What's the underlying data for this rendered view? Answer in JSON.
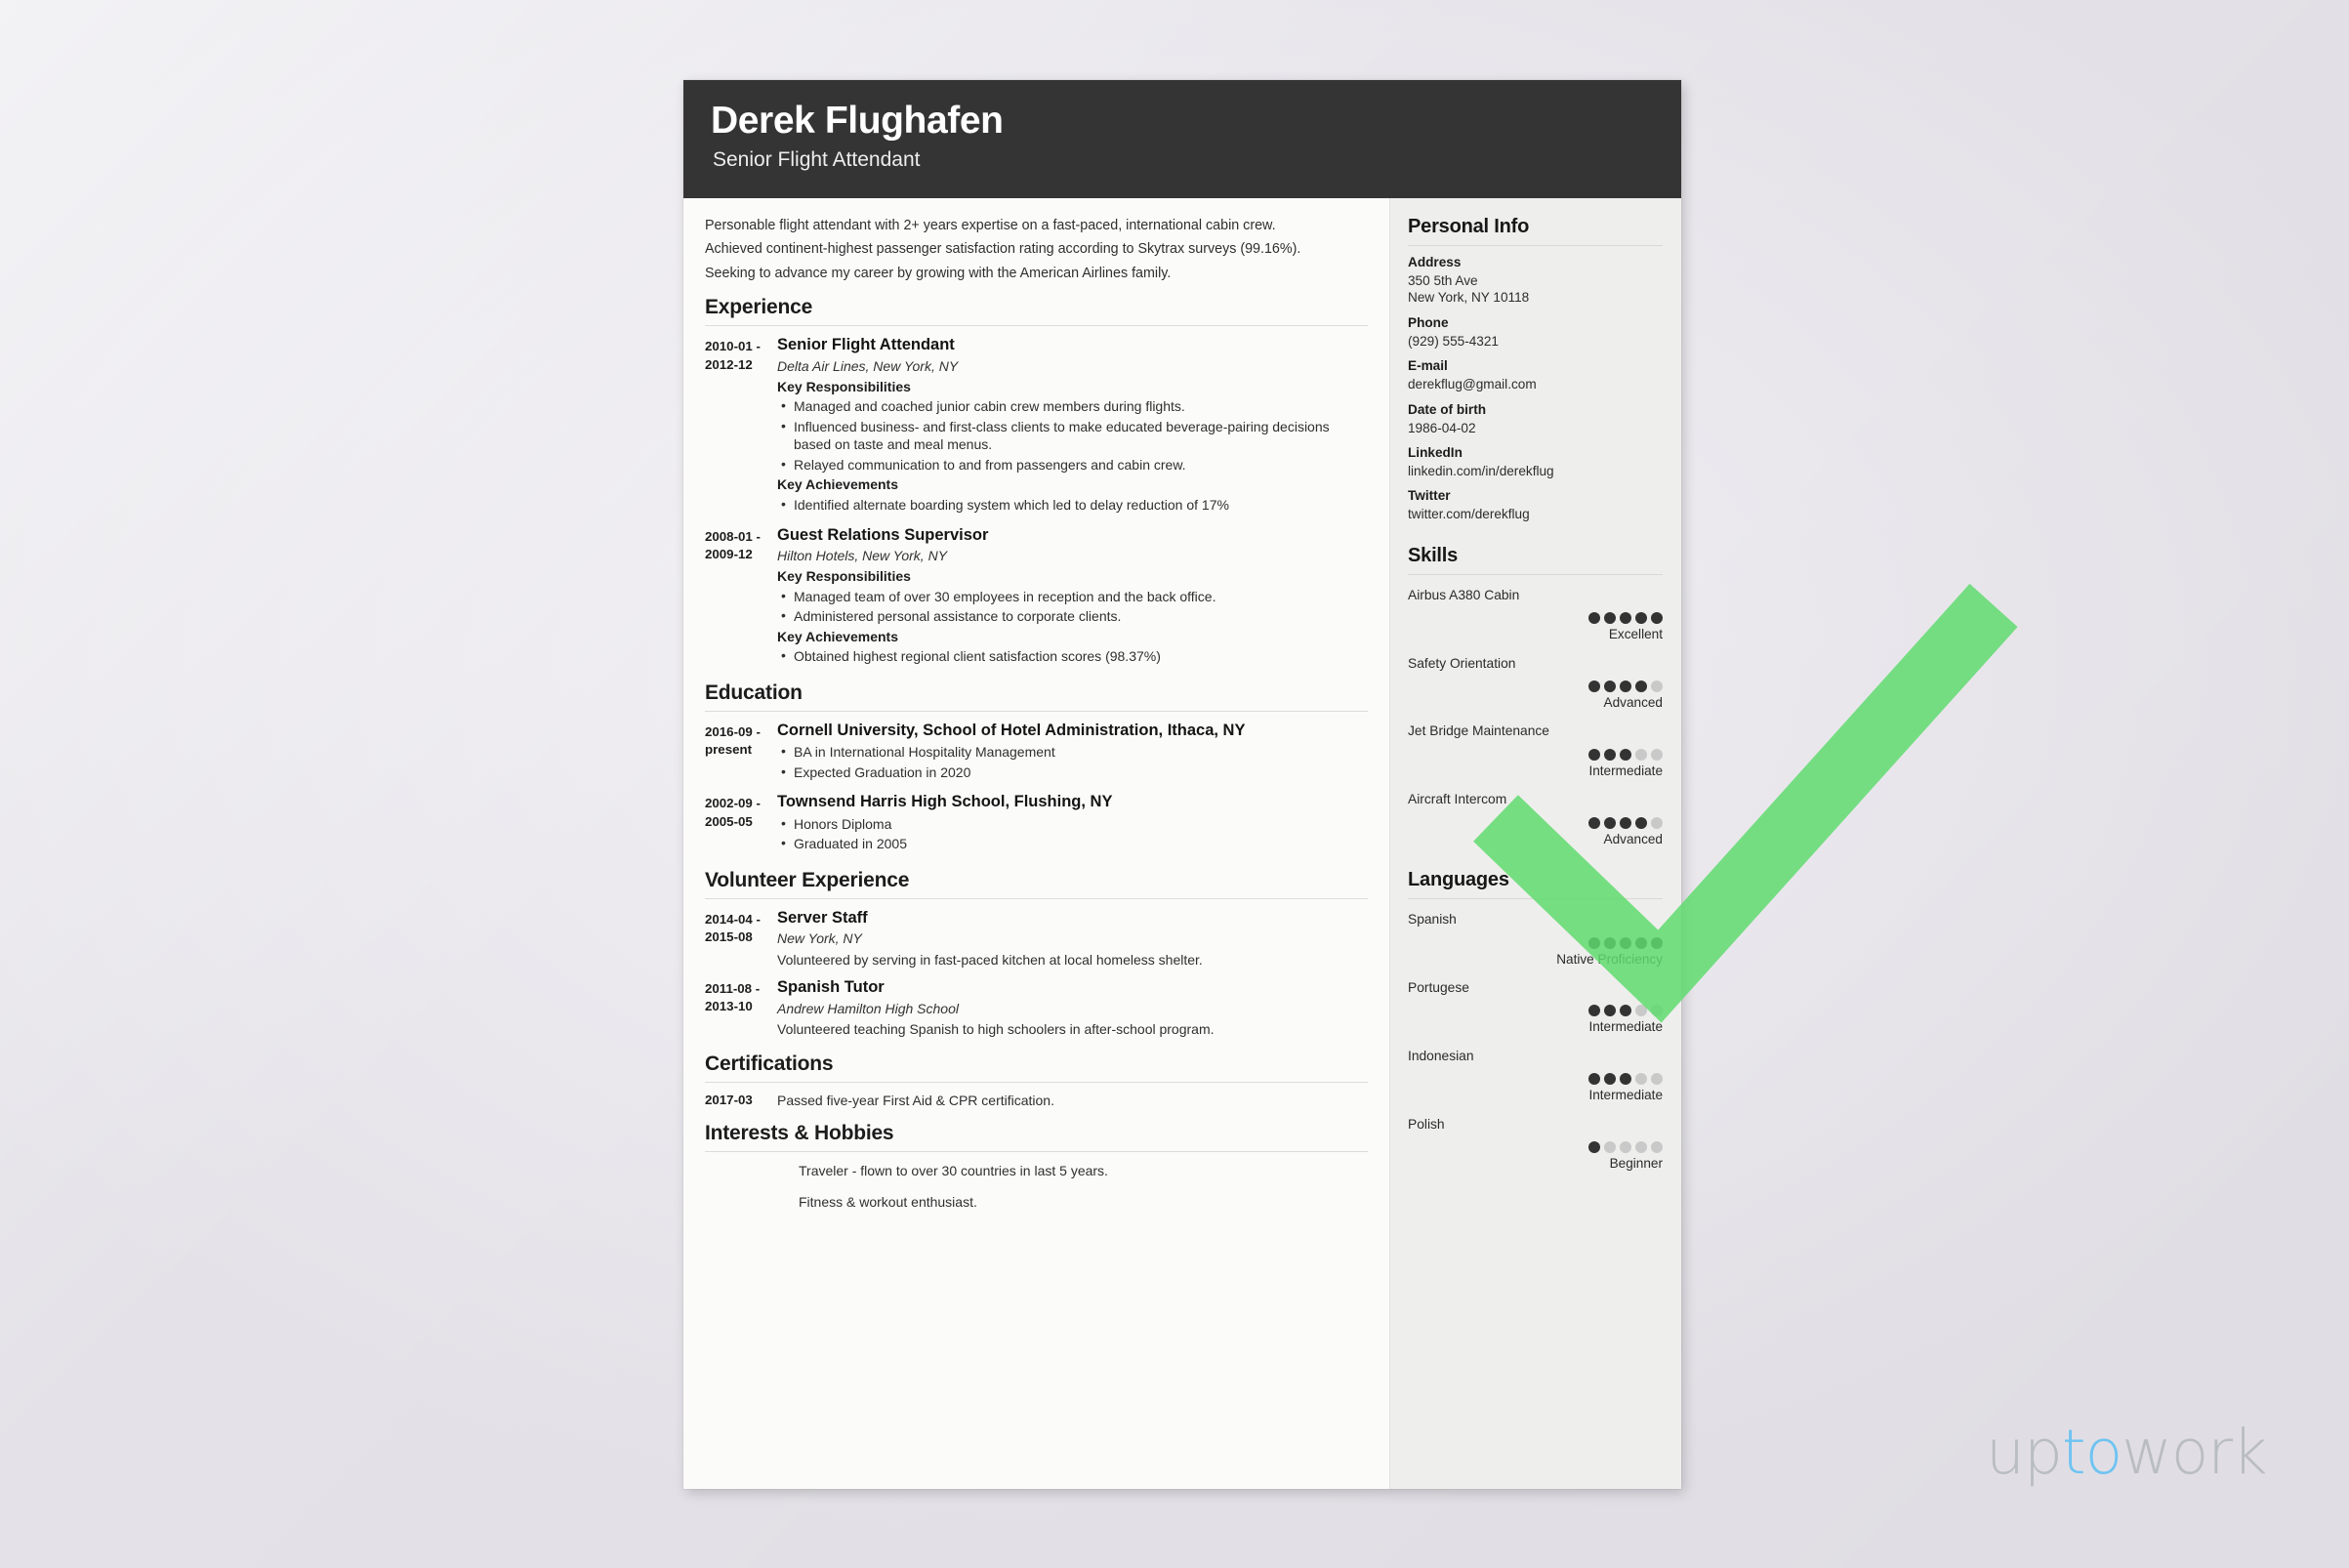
{
  "brand": {
    "part1": "up",
    "accent": "to",
    "part2": "work",
    "accent_color": "#6fc3f2",
    "base_color": "#b9bdc2"
  },
  "theme": {
    "header_bg": "#343434",
    "page_bg": "#fbfbfa",
    "sidebar_bg": "#eeeeec",
    "check_green": "#5fdb6f",
    "dot_on": "#333333",
    "dot_off": "#c9c9c9"
  },
  "header": {
    "name": "Derek Flughafen",
    "title": "Senior Flight Attendant"
  },
  "summary": [
    "Personable flight attendant with 2+ years expertise on a fast-paced, international cabin crew.",
    "Achieved continent-highest passenger satisfaction rating according to Skytrax surveys (99.16%).",
    "Seeking to advance my career by growing with the American Airlines family."
  ],
  "sections": {
    "experience": {
      "title": "Experience",
      "entries": [
        {
          "date_from": "2010-01 -",
          "date_to": "2012-12",
          "role": "Senior Flight Attendant",
          "org": "Delta Air Lines, New York, NY",
          "resp_label": "Key Responsibilities",
          "responsibilities": [
            "Managed and coached junior cabin crew members during flights.",
            "Influenced business- and first-class clients to make educated beverage-pairing decisions based on taste and meal menus.",
            "Relayed communication to and from passengers and cabin crew."
          ],
          "ach_label": "Key Achievements",
          "achievements": [
            "Identified alternate boarding system which led to delay reduction of 17%"
          ]
        },
        {
          "date_from": "2008-01 -",
          "date_to": "2009-12",
          "role": "Guest Relations Supervisor",
          "org": "Hilton Hotels, New York, NY",
          "resp_label": "Key Responsibilities",
          "responsibilities": [
            "Managed team of over 30 employees in reception and the back office.",
            "Administered personal assistance to corporate clients."
          ],
          "ach_label": "Key Achievements",
          "achievements": [
            "Obtained highest regional client satisfaction scores (98.37%)"
          ]
        }
      ]
    },
    "education": {
      "title": "Education",
      "entries": [
        {
          "date_from": "2016-09 -",
          "date_to": "present",
          "school": "Cornell University, School of Hotel Administration, Ithaca, NY",
          "points": [
            "BA in International Hospitality Management",
            "Expected Graduation in 2020"
          ]
        },
        {
          "date_from": "2002-09 -",
          "date_to": "2005-05",
          "school": "Townsend Harris High School, Flushing, NY",
          "points": [
            "Honors Diploma",
            "Graduated in 2005"
          ]
        }
      ]
    },
    "volunteer": {
      "title": "Volunteer Experience",
      "entries": [
        {
          "date_from": "2014-04 -",
          "date_to": "2015-08",
          "role": "Server Staff",
          "org": "New York, NY",
          "description": "Volunteered by serving in fast-paced kitchen at local homeless shelter."
        },
        {
          "date_from": "2011-08 -",
          "date_to": "2013-10",
          "role": "Spanish Tutor",
          "org": "Andrew Hamilton High School",
          "description": "Volunteered teaching Spanish to high schoolers in after-school program."
        }
      ]
    },
    "certifications": {
      "title": "Certifications",
      "entries": [
        {
          "date": "2017-03",
          "text": "Passed five-year First Aid & CPR certification."
        }
      ]
    },
    "interests": {
      "title": "Interests & Hobbies",
      "items": [
        "Traveler - flown to over 30 countries in last 5 years.",
        "Fitness & workout enthusiast."
      ]
    }
  },
  "sidebar": {
    "personal_info": {
      "title": "Personal Info",
      "fields": [
        {
          "label": "Address",
          "value": "350 5th Ave",
          "value2": "New York, NY 10118"
        },
        {
          "label": "Phone",
          "value": "(929) 555-4321"
        },
        {
          "label": "E-mail",
          "value": "derekflug@gmail.com"
        },
        {
          "label": "Date of birth",
          "value": "1986-04-02"
        },
        {
          "label": "LinkedIn",
          "value": "linkedin.com/in/derekflug"
        },
        {
          "label": "Twitter",
          "value": "twitter.com/derekflug"
        }
      ]
    },
    "skills": {
      "title": "Skills",
      "max": 5,
      "items": [
        {
          "name": "Airbus A380 Cabin",
          "filled": 5,
          "level": "Excellent"
        },
        {
          "name": "Safety Orientation",
          "filled": 4,
          "level": "Advanced"
        },
        {
          "name": "Jet Bridge Maintenance",
          "filled": 3,
          "level": "Intermediate"
        },
        {
          "name": "Aircraft Intercom",
          "filled": 4,
          "level": "Advanced"
        }
      ]
    },
    "languages": {
      "title": "Languages",
      "max": 5,
      "items": [
        {
          "name": "Spanish",
          "filled": 5,
          "level": "Native Proficiency"
        },
        {
          "name": "Portugese",
          "filled": 3,
          "level": "Intermediate"
        },
        {
          "name": "Indonesian",
          "filled": 3,
          "level": "Intermediate"
        },
        {
          "name": "Polish",
          "filled": 1,
          "level": "Beginner"
        }
      ]
    }
  }
}
